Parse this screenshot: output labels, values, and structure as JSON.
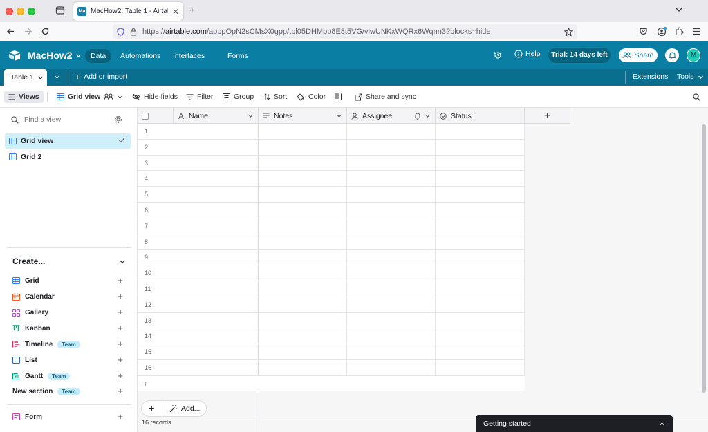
{
  "browser": {
    "tab_title": "MacHow2: Table 1 - Airtable",
    "favicon_text": "Ma",
    "url_prefix": "https://",
    "url_domain": "airtable.com",
    "url_path": "/apppOpN2sCMsX0gpp/tbl05DHMbp8E8t5VG/viwUNKxWQRx6Wqnn3?blocks=hide"
  },
  "header": {
    "base_name": "MacHow2",
    "nav": [
      "Data",
      "Automations",
      "Interfaces",
      "Forms"
    ],
    "help_label": "Help",
    "trial_label": "Trial: 14 days left",
    "share_label": "Share",
    "avatar_initial": "M"
  },
  "tablebar": {
    "table_tab": "Table 1",
    "add_import": "Add or import",
    "extensions": "Extensions",
    "tools": "Tools"
  },
  "toolbar": {
    "views": "Views",
    "grid_view": "Grid view",
    "hide_fields": "Hide fields",
    "filter": "Filter",
    "group": "Group",
    "sort": "Sort",
    "color": "Color",
    "share_sync": "Share and sync"
  },
  "sidebar": {
    "find_placeholder": "Find a view",
    "views": [
      "Grid view",
      "Grid 2"
    ],
    "create_label": "Create...",
    "create_items": [
      {
        "label": "Grid",
        "badge": "",
        "color": "#2d7ff9"
      },
      {
        "label": "Calendar",
        "badge": "",
        "color": "#f2541b"
      },
      {
        "label": "Gallery",
        "badge": "",
        "color": "#b34cd8"
      },
      {
        "label": "Kanban",
        "badge": "",
        "color": "#11a76f"
      },
      {
        "label": "Timeline",
        "badge": "Team",
        "color": "#d62e5c"
      },
      {
        "label": "List",
        "badge": "",
        "color": "#2d62d8"
      },
      {
        "label": "Gantt",
        "badge": "Team",
        "color": "#0f9b7a"
      },
      {
        "label": "New section",
        "badge": "Team",
        "color": ""
      }
    ],
    "form_label": "Form"
  },
  "grid": {
    "columns": [
      "Name",
      "Notes",
      "Assignee",
      "Status"
    ],
    "row_numbers": [
      "1",
      "2",
      "3",
      "4",
      "5",
      "6",
      "7",
      "8",
      "9",
      "10",
      "11",
      "12",
      "13",
      "14",
      "15",
      "16"
    ],
    "add_label": "Add...",
    "records_label": "16 records"
  },
  "footer": {
    "getting_started": "Getting started"
  },
  "colors": {
    "brand": "#0b7fa3",
    "brand_dark": "#0a6f8f",
    "selected_view": "#cfeffb"
  }
}
